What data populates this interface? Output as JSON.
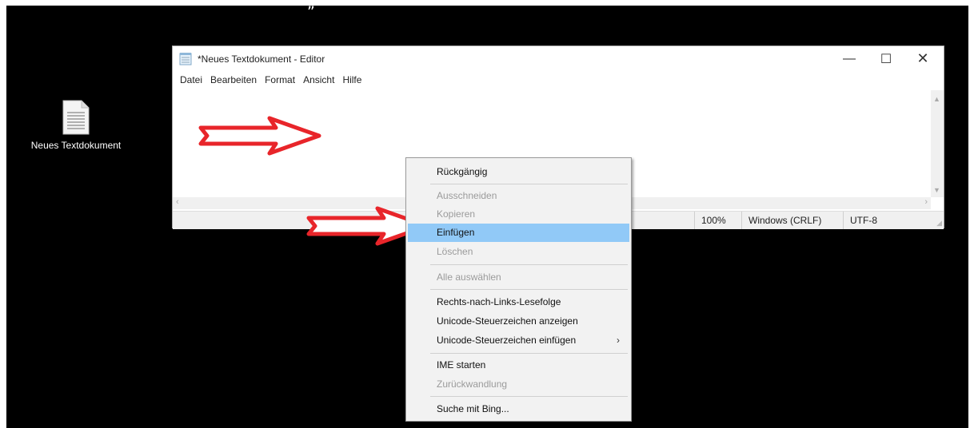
{
  "caption": "„",
  "desktop": {
    "icon_label": "Neues Textdokument"
  },
  "window": {
    "title": "*Neues Textdokument - Editor",
    "controls": {
      "minimize": "—",
      "maximize": "☐",
      "close": "✕"
    },
    "menu": [
      "Datei",
      "Bearbeiten",
      "Format",
      "Ansicht",
      "Hilfe"
    ],
    "status": {
      "zoom": "100%",
      "line_ending": "Windows (CRLF)",
      "encoding": "UTF-8"
    }
  },
  "context_menu": {
    "items": [
      {
        "label": "Rückgängig",
        "enabled": true
      },
      {
        "label": "Ausschneiden",
        "enabled": false
      },
      {
        "label": "Kopieren",
        "enabled": false
      },
      {
        "label": "Einfügen",
        "enabled": true,
        "highlighted": true
      },
      {
        "label": "Löschen",
        "enabled": false
      },
      {
        "label": "Alle auswählen",
        "enabled": false
      },
      {
        "label": "Rechts-nach-Links-Lesefolge",
        "enabled": true
      },
      {
        "label": "Unicode-Steuerzeichen anzeigen",
        "enabled": true
      },
      {
        "label": "Unicode-Steuerzeichen einfügen",
        "enabled": true,
        "submenu": true
      },
      {
        "label": "IME starten",
        "enabled": true
      },
      {
        "label": "Zurückwandlung",
        "enabled": false
      },
      {
        "label": "Suche mit Bing...",
        "enabled": true
      }
    ],
    "submenu_glyph": "›"
  },
  "colors": {
    "highlight": "#91c9f7",
    "arrow": "#e8252a",
    "disabled_text": "#9b9b9b"
  }
}
